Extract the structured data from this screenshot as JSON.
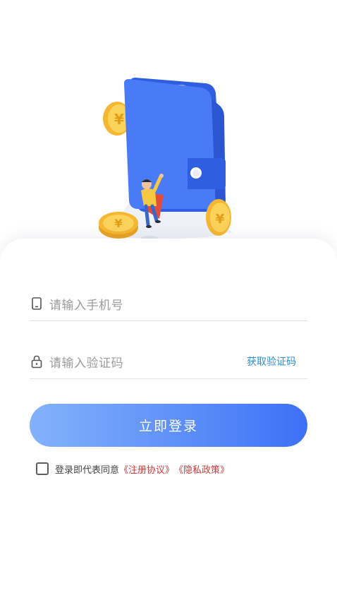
{
  "hero": {
    "illustration": "wallet-with-coins-illustration",
    "currency_symbol": "¥"
  },
  "login_form": {
    "phone_placeholder": "请输入手机号",
    "phone_icon": "phone-icon",
    "code_placeholder": "请输入验证码",
    "code_icon": "lock-icon",
    "get_code_label": "获取验证码",
    "submit_label": "立即登录"
  },
  "agreement": {
    "checked": false,
    "prefix_text": "登录即代表同意",
    "terms_link": "《注册协议》",
    "privacy_link": "《隐私政策》"
  },
  "colors": {
    "accent_blue": "#4a7bf7",
    "link_blue": "#2b8fd8",
    "policy_red": "#d23a3a",
    "button_gradient_start": "#83b2fb",
    "button_gradient_end": "#3d6ff6"
  }
}
